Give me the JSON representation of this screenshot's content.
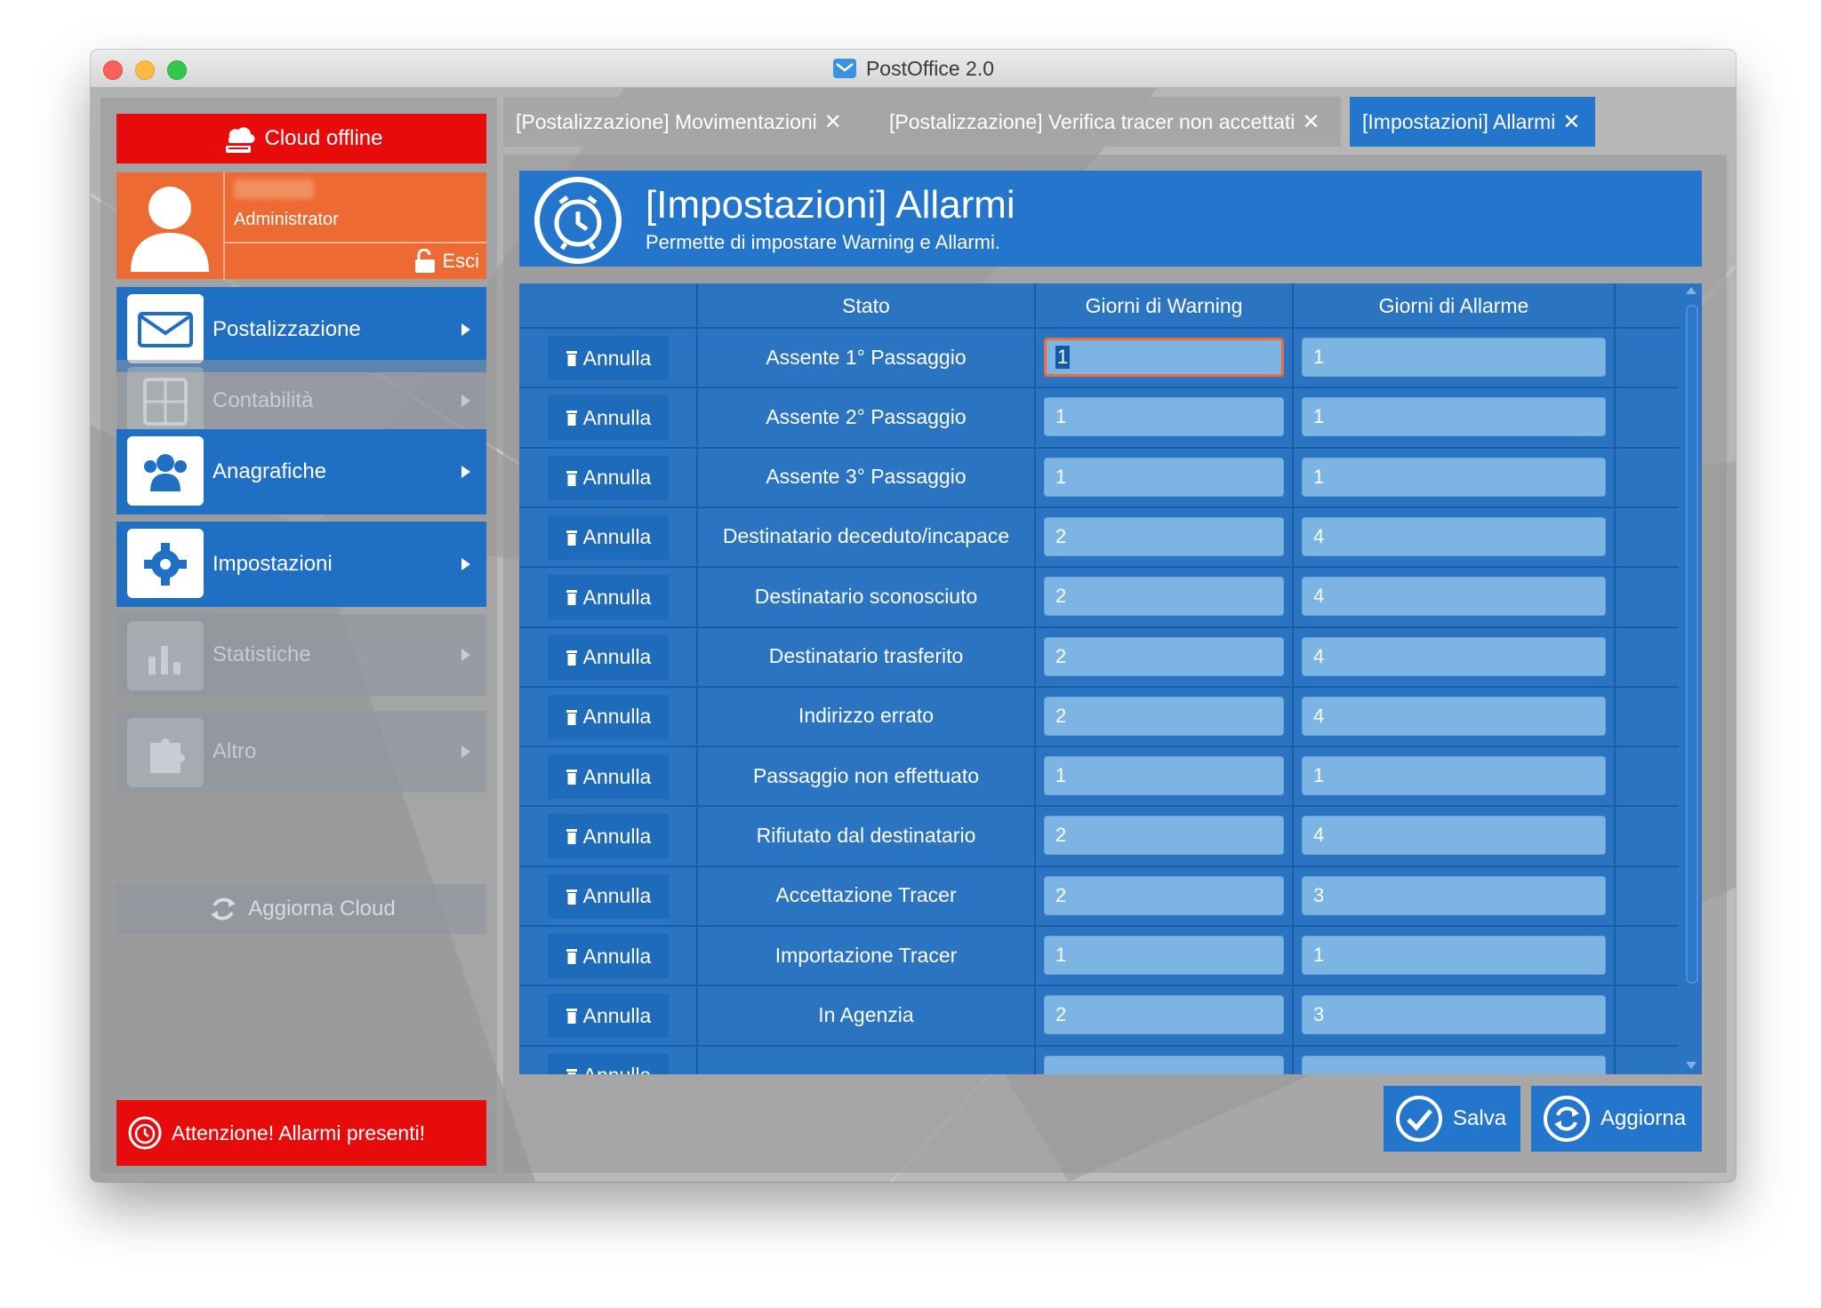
{
  "window": {
    "title": "PostOffice 2.0"
  },
  "sidebar": {
    "cloud_status": "Cloud offline",
    "user": {
      "role": "Administrator",
      "logout_label": "Esci"
    },
    "menu": [
      {
        "label": "Postalizzazione",
        "enabled": true,
        "icon": "mail-icon"
      },
      {
        "label": "Contabilità",
        "enabled": false,
        "icon": "calculator-icon"
      },
      {
        "label": "Anagrafiche",
        "enabled": true,
        "icon": "users-icon"
      },
      {
        "label": "Impostazioni",
        "enabled": true,
        "icon": "gear-icon"
      },
      {
        "label": "Statistiche",
        "enabled": false,
        "icon": "bar-chart-icon"
      },
      {
        "label": "Altro",
        "enabled": false,
        "icon": "puzzle-icon"
      }
    ],
    "sync_label": "Aggiorna Cloud",
    "alert_label": "Attenzione! Allarmi presenti!"
  },
  "tabs": [
    {
      "label": "[Postalizzazione] Movimentazioni",
      "active": false
    },
    {
      "label": "[Postalizzazione] Verifica tracer non accettati",
      "active": false
    },
    {
      "label": "[Impostazioni] Allarmi",
      "active": true
    }
  ],
  "tab_close_glyph": "✕",
  "header": {
    "title": "[Impostazioni] Allarmi",
    "subtitle": "Permette di impostare Warning e Allarmi."
  },
  "table": {
    "columns": [
      "",
      "Stato",
      "Giorni di Warning",
      "Giorni di Allarme"
    ],
    "cancel_label": "Annulla",
    "rows": [
      {
        "stato": "Assente 1° Passaggio",
        "warning": "1",
        "allarme": "1"
      },
      {
        "stato": "Assente 2° Passaggio",
        "warning": "1",
        "allarme": "1"
      },
      {
        "stato": "Assente 3° Passaggio",
        "warning": "1",
        "allarme": "1"
      },
      {
        "stato": "Destinatario deceduto/incapace",
        "warning": "2",
        "allarme": "4"
      },
      {
        "stato": "Destinatario sconosciuto",
        "warning": "2",
        "allarme": "4"
      },
      {
        "stato": "Destinatario trasferito",
        "warning": "2",
        "allarme": "4"
      },
      {
        "stato": "Indirizzo errato",
        "warning": "2",
        "allarme": "4"
      },
      {
        "stato": "Passaggio non effettuato",
        "warning": "1",
        "allarme": "1"
      },
      {
        "stato": "Rifiutato dal destinatario",
        "warning": "2",
        "allarme": "4"
      },
      {
        "stato": "Accettazione Tracer",
        "warning": "2",
        "allarme": "3"
      },
      {
        "stato": "Importazione Tracer",
        "warning": "1",
        "allarme": "1"
      },
      {
        "stato": "In Agenzia",
        "warning": "2",
        "allarme": "3"
      },
      {
        "stato": "",
        "warning": "",
        "allarme": ""
      }
    ]
  },
  "actions": {
    "save_label": "Salva",
    "refresh_label": "Aggiorna"
  },
  "colors": {
    "accent_blue": "#2476cc",
    "alert_red": "#e80b0b",
    "user_orange": "#ee6a33",
    "focus_orange": "#f06a3a"
  }
}
